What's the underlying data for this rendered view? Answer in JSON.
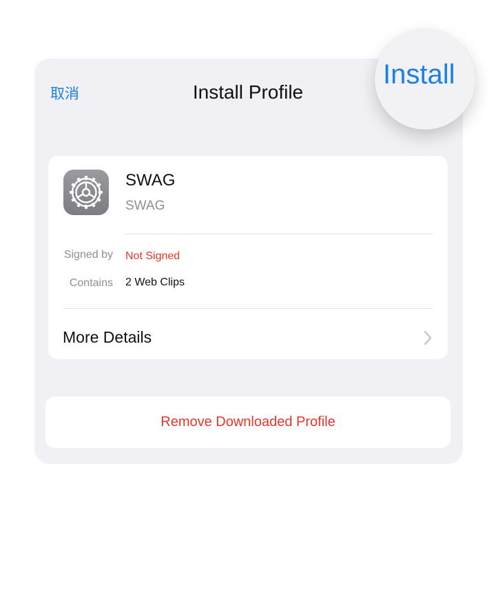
{
  "header": {
    "cancel_label": "取消",
    "title": "Install Profile",
    "install_label": "Install"
  },
  "profile": {
    "icon": "gear-icon",
    "name": "SWAG",
    "organization": "SWAG"
  },
  "details": {
    "signed_by_label": "Signed by",
    "signed_by_value": "Not Signed",
    "contains_label": "Contains",
    "contains_value": "2 Web Clips"
  },
  "more_details": {
    "label": "More Details",
    "icon": "chevron-right-icon"
  },
  "remove_label": "Remove Downloaded Profile",
  "colors": {
    "accent": "#1a7fe6",
    "destructive": "#e8352c",
    "sheet_background": "#f1f1f5",
    "secondary_text": "#8e8e93"
  }
}
